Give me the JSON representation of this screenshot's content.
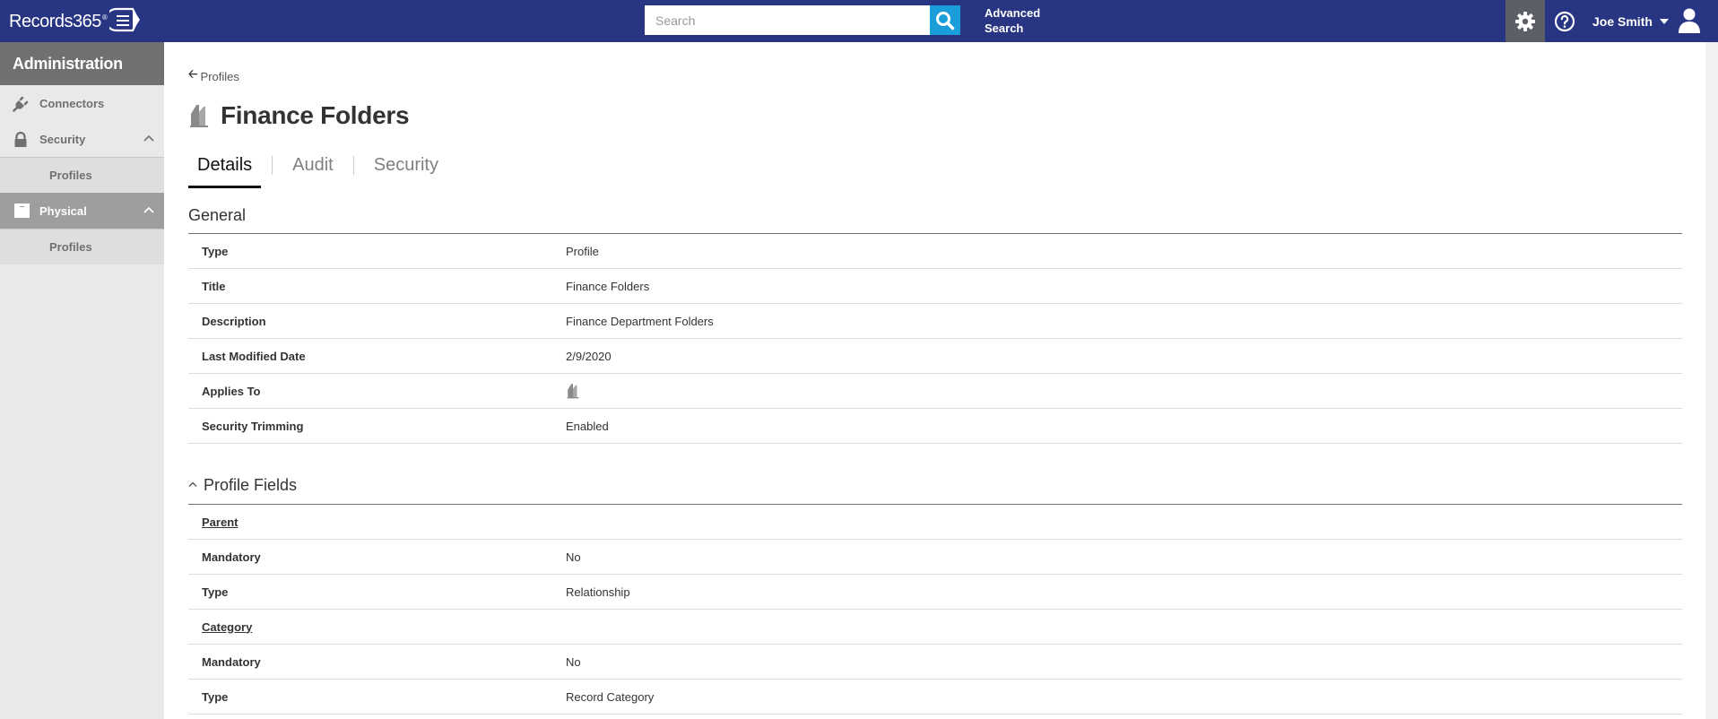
{
  "header": {
    "logo_text": "Records365",
    "logo_sup": "®",
    "search_placeholder": "Search",
    "advanced_search_line1": "Advanced",
    "advanced_search_line2": "Search",
    "user_name": "Joe Smith"
  },
  "sidebar": {
    "title": "Administration",
    "items": [
      {
        "label": "Connectors",
        "icon": "plug-icon"
      },
      {
        "label": "Security",
        "icon": "lock-icon",
        "sub": "Profiles"
      },
      {
        "label": "Physical",
        "icon": "box-icon",
        "sub": "Profiles"
      }
    ]
  },
  "main": {
    "back_label": "Profiles",
    "title": "Finance Folders",
    "tabs": [
      "Details",
      "Audit",
      "Security"
    ],
    "general": {
      "title": "General",
      "rows": [
        {
          "key": "Type",
          "value": "Profile"
        },
        {
          "key": "Title",
          "value": "Finance Folders"
        },
        {
          "key": "Description",
          "value": "Finance Department Folders"
        },
        {
          "key": "Last Modified Date",
          "value": "2/9/2020"
        },
        {
          "key": "Applies To",
          "value": ""
        },
        {
          "key": "Security Trimming",
          "value": "Enabled"
        }
      ]
    },
    "profile_fields": {
      "title": "Profile Fields",
      "rows": [
        {
          "key": "Parent",
          "value": ""
        },
        {
          "key": "Mandatory",
          "value": "No"
        },
        {
          "key": "Type",
          "value": "Relationship"
        },
        {
          "key": "Category",
          "value": ""
        },
        {
          "key": "Mandatory",
          "value": "No"
        },
        {
          "key": "Type",
          "value": "Record Category"
        }
      ]
    }
  },
  "colors": {
    "topbar": "#283583",
    "search_button": "#1a9ed9",
    "sidebar_header": "#707070",
    "sidebar_active": "#9e9e9e"
  }
}
